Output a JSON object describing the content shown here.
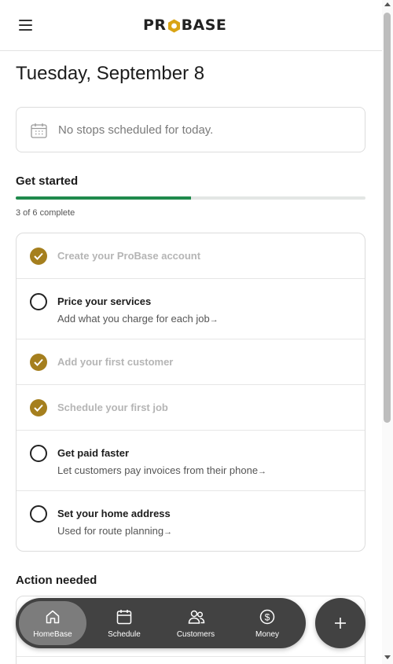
{
  "header": {
    "logo_text": "PROBASE",
    "logo_left": "PR",
    "logo_right": "BASE",
    "menu_icon": "hamburger-menu-icon"
  },
  "date_title": "Tuesday, September 8",
  "stops": {
    "icon": "calendar-icon",
    "text": "No stops scheduled for today."
  },
  "get_started": {
    "title": "Get started",
    "progress_fraction": 0.5,
    "progress_text": "3 of 6 complete",
    "progress_color": "#1f8a4c",
    "tasks": [
      {
        "title": "Create your ProBase account",
        "subtitle": "",
        "done": true
      },
      {
        "title": "Price your services",
        "subtitle": "Add what you charge for each job",
        "done": false
      },
      {
        "title": "Add your first customer",
        "subtitle": "",
        "done": true
      },
      {
        "title": "Schedule your first job",
        "subtitle": "",
        "done": true
      },
      {
        "title": "Get paid faster",
        "subtitle": "Let customers pay invoices from their phone",
        "done": false
      },
      {
        "title": "Set your home address",
        "subtitle": "Used for route planning",
        "done": false
      }
    ],
    "arrow": "→",
    "check_color": "#a57f1e"
  },
  "action_needed": {
    "title": "Action needed"
  },
  "bottom_nav": {
    "items": [
      {
        "label": "HomeBase",
        "icon": "home-icon",
        "active": true
      },
      {
        "label": "Schedule",
        "icon": "calendar-icon",
        "active": false
      },
      {
        "label": "Customers",
        "icon": "users-icon",
        "active": false
      },
      {
        "label": "Money",
        "icon": "dollar-icon",
        "active": false
      }
    ],
    "fab_icon": "plus-icon"
  },
  "colors": {
    "accent_gold": "#a57f1e",
    "progress_green": "#1f8a4c",
    "nav_bg": "#424242"
  }
}
